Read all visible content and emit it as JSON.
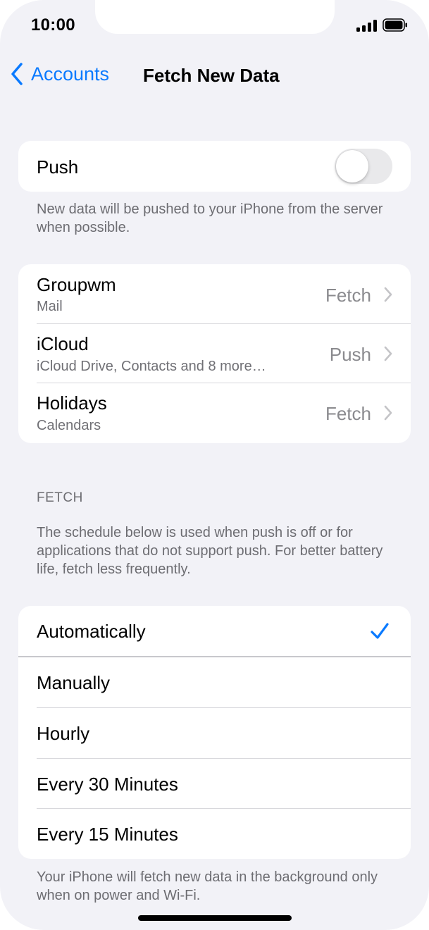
{
  "status_bar": {
    "time": "10:00"
  },
  "nav": {
    "back_label": "Accounts",
    "title": "Fetch New Data"
  },
  "push": {
    "label": "Push",
    "enabled": false,
    "footnote": "New data will be pushed to your iPhone from the server when possible."
  },
  "accounts": [
    {
      "name": "Groupwm",
      "detail": "Mail",
      "mode": "Fetch"
    },
    {
      "name": "iCloud",
      "detail": "iCloud Drive, Contacts and 8 more…",
      "mode": "Push"
    },
    {
      "name": "Holidays",
      "detail": "Calendars",
      "mode": "Fetch"
    }
  ],
  "fetch": {
    "header": "FETCH",
    "description": "The schedule below is used when push is off or for applications that do not support push. For better battery life, fetch less frequently.",
    "options": [
      {
        "label": "Automatically",
        "selected": true
      },
      {
        "label": "Manually",
        "selected": false
      },
      {
        "label": "Hourly",
        "selected": false
      },
      {
        "label": "Every 30 Minutes",
        "selected": false
      },
      {
        "label": "Every 15 Minutes",
        "selected": false
      }
    ],
    "footnote": "Your iPhone will fetch new data in the background only when on power and Wi-Fi."
  },
  "colors": {
    "accent": "#0a7aff",
    "background": "#f2f2f7",
    "secondary_text": "#6d6d72",
    "toggle_off": "#e9e9eb"
  },
  "icons": {
    "back": "chevron-left-icon",
    "disclosure": "chevron-right-icon",
    "check": "checkmark-icon",
    "signal": "cellular-signal-icon",
    "battery": "battery-icon"
  }
}
